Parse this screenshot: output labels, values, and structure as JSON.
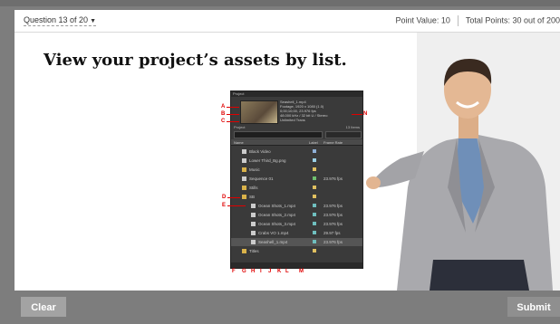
{
  "question": {
    "number_label": "Question 13 of 20",
    "point_value": "Point Value: 10",
    "total_points": "Total Points: 30 out of 200",
    "title": "View your project’s assets by list."
  },
  "panel": {
    "tab_label": "Project",
    "info_lines": [
      "Seashell_1.mp4",
      "Footage, 1920 x 1080 (1.0)",
      "0;00;10;00, 23.976 fps",
      "48.000 kHz / 32 bit U / Stereo",
      "Unlimited Trans"
    ],
    "search_label": "Project",
    "item_count": "13 Items",
    "header_name": "Name",
    "header_label": "Label",
    "header_fps": "Frame Rate",
    "rows": [
      {
        "name": "Black Video",
        "swatch": "#8fb0d6",
        "fps": ""
      },
      {
        "name": "Lower Third_Bg.png",
        "swatch": "#9bd0e6",
        "fps": ""
      },
      {
        "name": "Music",
        "swatch": "#e0c060",
        "fps": ""
      },
      {
        "name": "Sequence 01",
        "swatch": "#6fbf6f",
        "fps": "23.976 fps"
      },
      {
        "name": "Stills",
        "swatch": "#e0c060",
        "fps": ""
      },
      {
        "name": "SB",
        "swatch": "#e0c060",
        "fps": ""
      },
      {
        "name": "Ocean Shots_1.mp4",
        "swatch": "#6fbfbf",
        "fps": "23.976 fps"
      },
      {
        "name": "Ocean Shots_2.mp4",
        "swatch": "#6fbfbf",
        "fps": "23.976 fps"
      },
      {
        "name": "Ocean Shots_3.mp4",
        "swatch": "#6fbfbf",
        "fps": "23.976 fps"
      },
      {
        "name": "Crabs VO 1.mp4",
        "swatch": "#6fbfbf",
        "fps": "29.97 fps"
      },
      {
        "name": "Seashell_1.mp4",
        "swatch": "#6fbfbf",
        "fps": "23.976 fps"
      },
      {
        "name": "Titles",
        "swatch": "#e0c060",
        "fps": ""
      }
    ],
    "callouts": [
      "A",
      "B",
      "C",
      "D",
      "E",
      "F",
      "G",
      "H",
      "I",
      "J",
      "K",
      "L",
      "M",
      "N"
    ]
  },
  "buttons": {
    "clear": "Clear",
    "submit": "Submit"
  },
  "colors": {
    "frame": "#7d7d7d",
    "callout": "#e00000",
    "panel_bg": "#3a3a3a",
    "folder": "#e0c060"
  }
}
